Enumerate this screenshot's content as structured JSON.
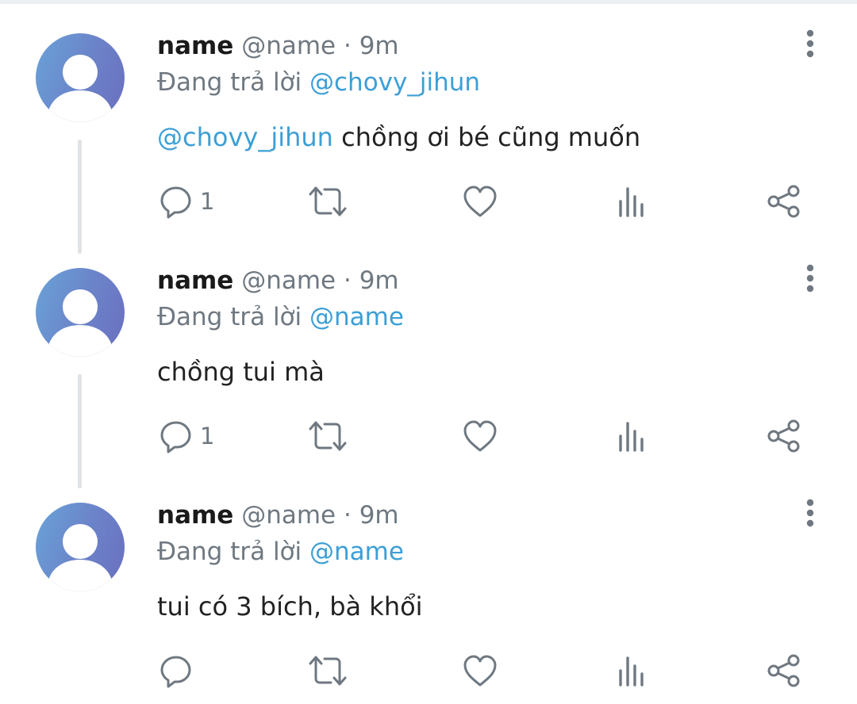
{
  "colors": {
    "mention": "#3c9fd6",
    "muted": "#6f7880",
    "avatar_gradient": [
      "#6aa3d8",
      "#6b6fc0"
    ]
  },
  "tweets": [
    {
      "display_name": "name",
      "handle": "@name",
      "separator": "·",
      "time": "9m",
      "reply_prefix": "Đang trả lời",
      "reply_to": "@chovy_jihun",
      "body_mention": "@chovy_jihun",
      "body_text": " chồng ơi bé cũng muốn",
      "reply_count": "1",
      "icons": [
        "reply-icon",
        "retweet-icon",
        "like-icon",
        "analytics-icon",
        "share-icon",
        "more-icon"
      ]
    },
    {
      "display_name": "name",
      "handle": "@name",
      "separator": "·",
      "time": "9m",
      "reply_prefix": "Đang trả lời",
      "reply_to": "@name",
      "body_mention": "",
      "body_text": "chồng tui mà",
      "reply_count": "1",
      "icons": [
        "reply-icon",
        "retweet-icon",
        "like-icon",
        "analytics-icon",
        "share-icon",
        "more-icon"
      ]
    },
    {
      "display_name": "name",
      "handle": "@name",
      "separator": "·",
      "time": "9m",
      "reply_prefix": "Đang trả lời",
      "reply_to": "@name",
      "body_mention": "",
      "body_text": "tui có 3 bích, bà khổi",
      "reply_count": "",
      "icons": [
        "reply-icon",
        "retweet-icon",
        "like-icon",
        "analytics-icon",
        "share-icon",
        "more-icon"
      ]
    }
  ]
}
